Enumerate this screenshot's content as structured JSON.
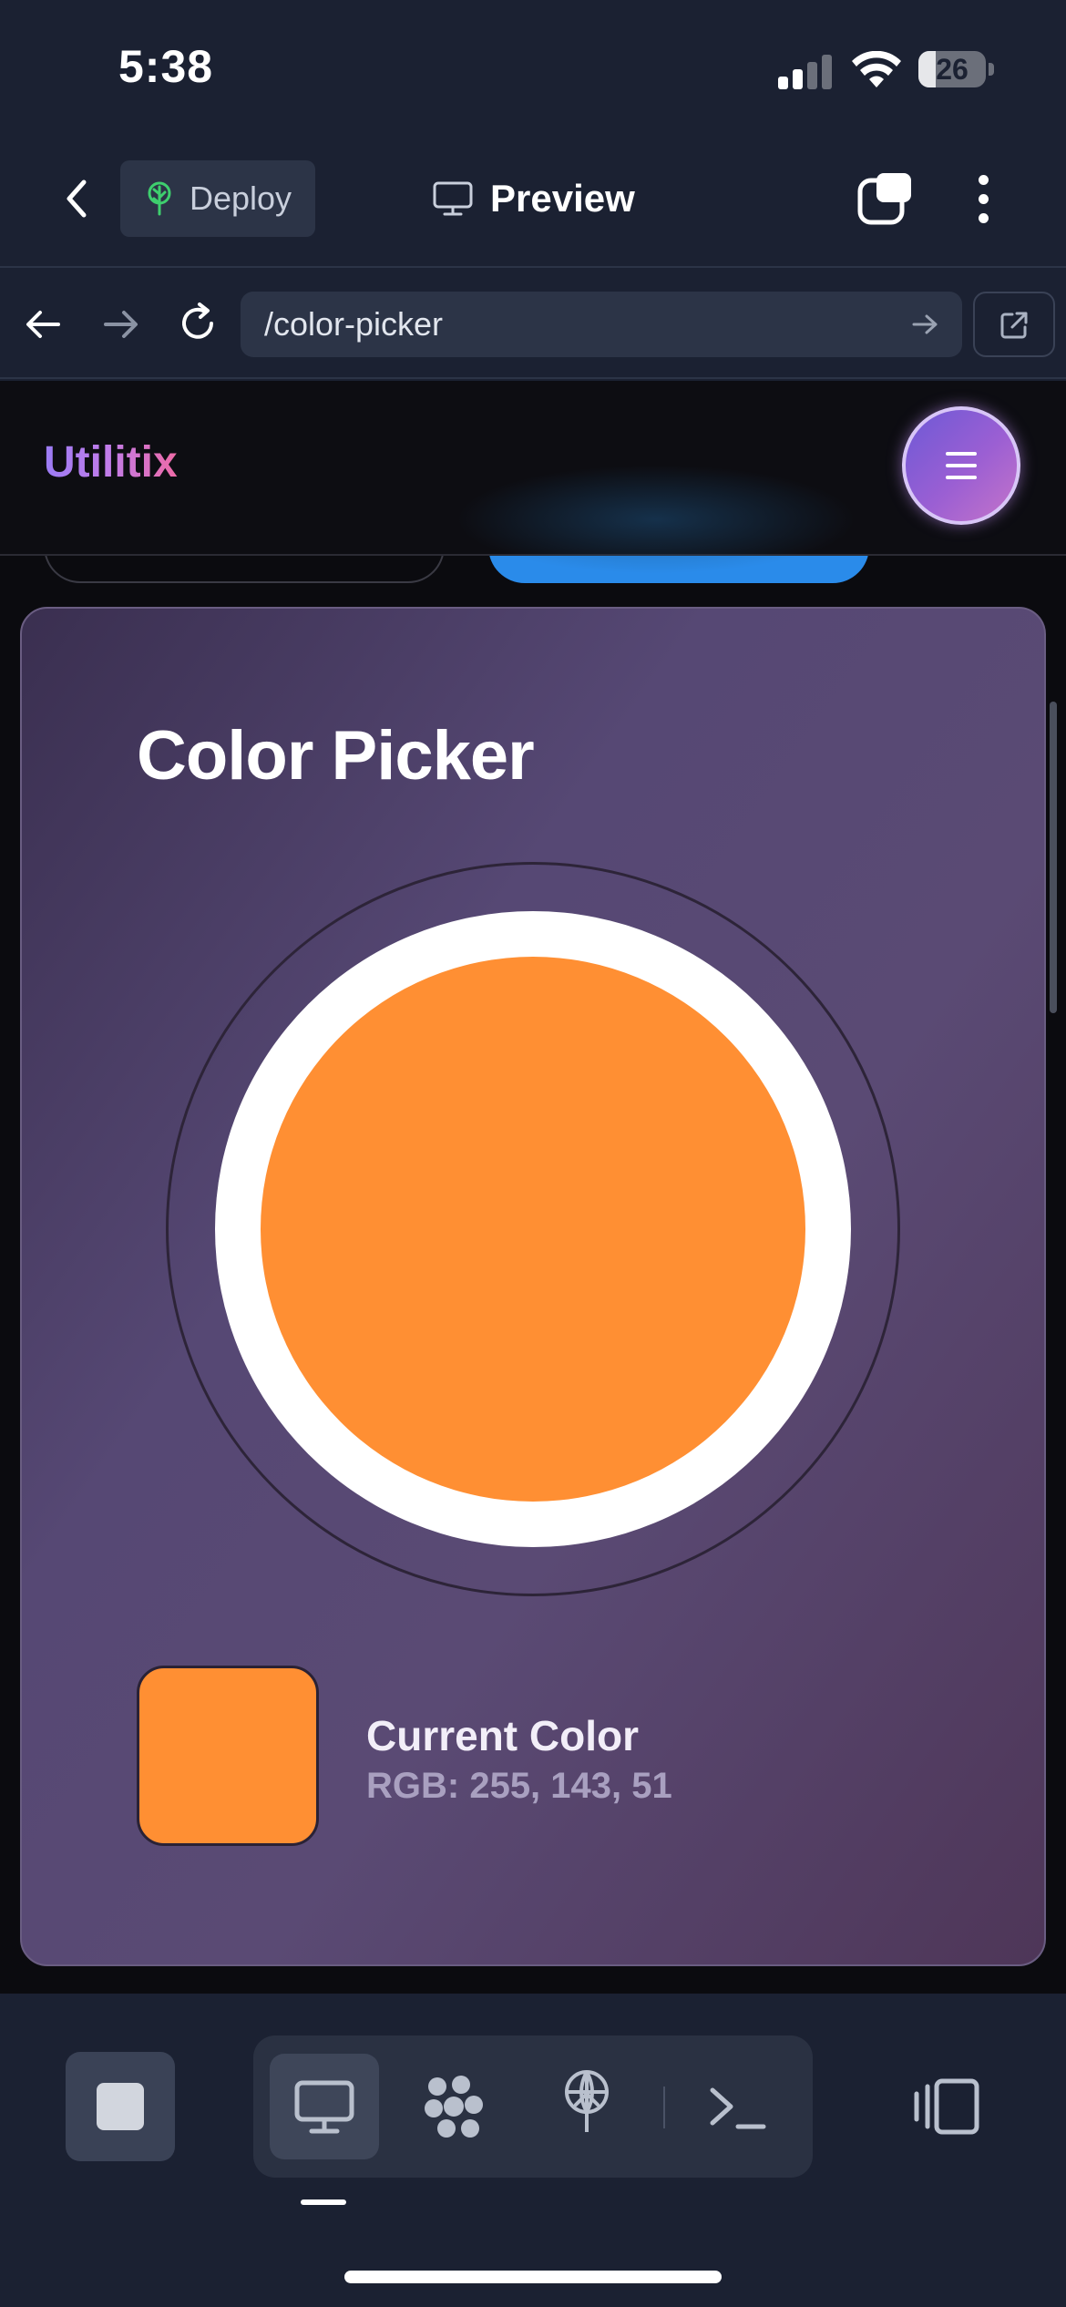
{
  "status_bar": {
    "time": "5:38",
    "battery_level": "26",
    "battery_fraction": 0.26
  },
  "app_header": {
    "deploy_label": "Deploy",
    "preview_label": "Preview"
  },
  "browser": {
    "url": "/color-picker"
  },
  "site": {
    "logo": "Utilitix"
  },
  "color_picker": {
    "title": "Color Picker",
    "current_label": "Current Color",
    "rgb_text": "RGB: 255, 143, 51",
    "current_color_hex": "#ff8f33"
  },
  "colors": {
    "accent_blue": "#2a8bea",
    "menu_gradient_start": "#6d59d6",
    "menu_gradient_end": "#c574c9",
    "card_gradient_start": "#3a2f50",
    "card_gradient_end": "#4e3658"
  },
  "icons": {
    "back": "chevron-left-icon",
    "deploy": "tree-icon",
    "preview": "monitor-icon",
    "tabs": "tabs-icon",
    "more": "vertical-dots-icon",
    "nav_back": "arrow-left-icon",
    "nav_forward": "arrow-right-icon",
    "reload": "reload-icon",
    "go": "arrow-right-icon",
    "external": "external-link-icon",
    "menu": "hamburger-icon",
    "stop": "stop-icon",
    "desktop": "desktop-icon",
    "flower": "flower-icon",
    "antenna": "antenna-icon",
    "terminal": "terminal-icon",
    "panel": "panel-icon"
  }
}
